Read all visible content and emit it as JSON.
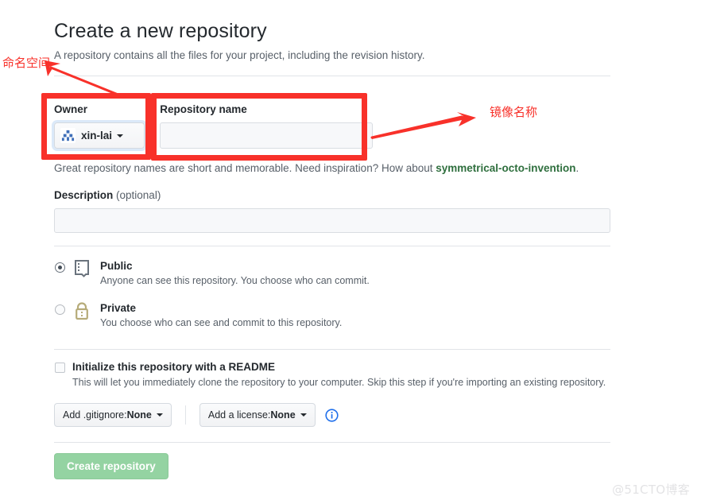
{
  "header": {
    "title": "Create a new repository",
    "subtitle": "A repository contains all the files for your project, including the revision history."
  },
  "owner": {
    "label": "Owner",
    "name": "xin-lai",
    "avatar_icon": "identicon-avatar",
    "caret_icon": "chevron-down-icon"
  },
  "separator": "/",
  "repository_name": {
    "label": "Repository name",
    "value": "",
    "placeholder": ""
  },
  "hint": {
    "prefix": "Great repository names are short and memorable. Need inspiration? How about ",
    "suggestion": "symmetrical-octo-invention",
    "suffix": "."
  },
  "description": {
    "label": "Description",
    "optional": "(optional)",
    "value": "",
    "placeholder": ""
  },
  "visibility": {
    "options": [
      {
        "id": "public",
        "title": "Public",
        "desc": "Anyone can see this repository. You choose who can commit.",
        "icon": "repo-book-icon",
        "selected": true
      },
      {
        "id": "private",
        "title": "Private",
        "desc": "You choose who can see and commit to this repository.",
        "icon": "lock-icon",
        "selected": false
      }
    ]
  },
  "initialize": {
    "checkbox_label": "Initialize this repository with a README",
    "checkbox_desc": "This will let you immediately clone the repository to your computer. Skip this step if you're importing an existing repository.",
    "checked": false,
    "gitignore_prefix": "Add .gitignore: ",
    "gitignore_value": "None",
    "license_prefix": "Add a license: ",
    "license_value": "None",
    "info_icon": "info-circle-icon"
  },
  "submit": {
    "label": "Create repository",
    "disabled": true,
    "color": "#94d3a2"
  },
  "annotations": {
    "accent_color": "#f8312a",
    "namespace_label": "命名空间",
    "image_name_label": "镜像名称"
  },
  "watermark": "@51CTO博客"
}
